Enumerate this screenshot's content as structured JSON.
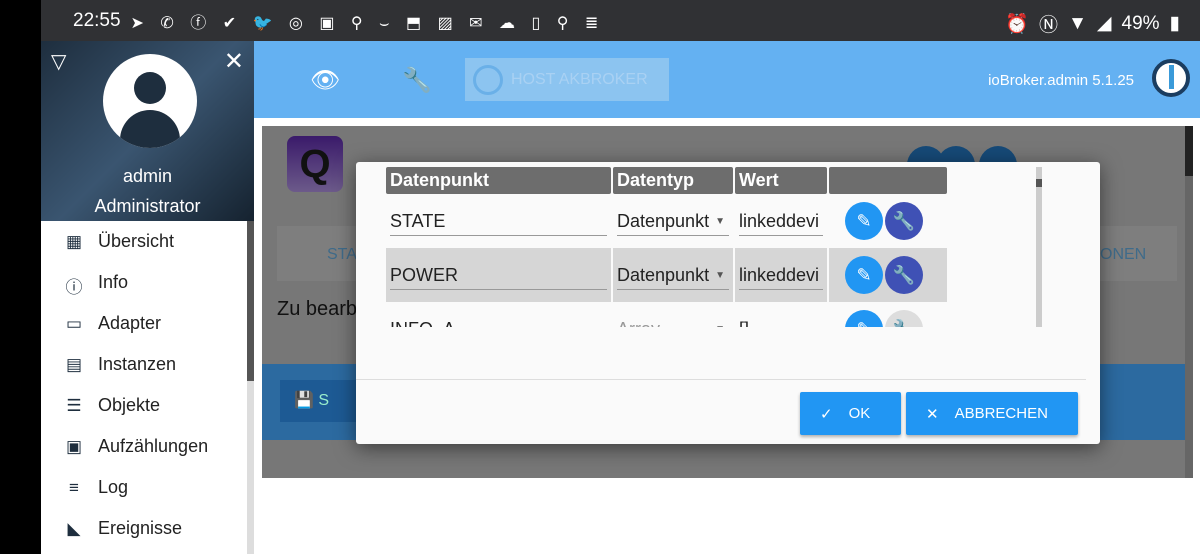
{
  "status_bar": {
    "time": "22:55",
    "notification_icons": "➤ ✆ ⓕ ✔ 🐦 ◎ ▣ ⚲ ⌣ ⬒ ▨ ✉ ☁ ▯ ⚲ ≣",
    "battery": "49%",
    "icons": [
      "alarm-icon",
      "nfc-icon",
      "wifi-icon",
      "signal-icon",
      "battery-icon"
    ]
  },
  "sidebar": {
    "user": "admin",
    "role": "Administrator",
    "items": [
      {
        "label": "Übersicht",
        "icon": "▦"
      },
      {
        "label": "Info",
        "icon": "ⓘ"
      },
      {
        "label": "Adapter",
        "icon": "▭"
      },
      {
        "label": "Instanzen",
        "icon": "▤"
      },
      {
        "label": "Objekte",
        "icon": "☰"
      },
      {
        "label": "Aufzählungen",
        "icon": "▣"
      },
      {
        "label": "Log",
        "icon": "≡"
      },
      {
        "label": "Ereignisse",
        "icon": "◣"
      }
    ]
  },
  "header": {
    "host_label": "HOST AKBROKER",
    "version": "ioBroker.admin 5.1.25"
  },
  "background": {
    "logo_letter": "Q",
    "tab_left": "STA",
    "tab_right": "ONEN",
    "edit_text": "Zu bearb",
    "save_label": "S"
  },
  "dialog": {
    "columns": [
      "Datenpunkt",
      "Datentyp",
      "Wert",
      ""
    ],
    "rows": [
      {
        "name": "STATE",
        "type": "Datenpunkt",
        "value": "linkeddevi",
        "selected": false
      },
      {
        "name": "POWER",
        "type": "Datenpunkt",
        "value": "linkeddevi",
        "selected": true
      },
      {
        "name": "INFO_A",
        "type": "Array",
        "value": "[]",
        "selected": false
      }
    ],
    "ok_label": "OK",
    "cancel_label": "ABBRECHEN"
  },
  "colors": {
    "header": "#64b1f2",
    "primary": "#2196f3",
    "wrench": "#3f51b5"
  }
}
